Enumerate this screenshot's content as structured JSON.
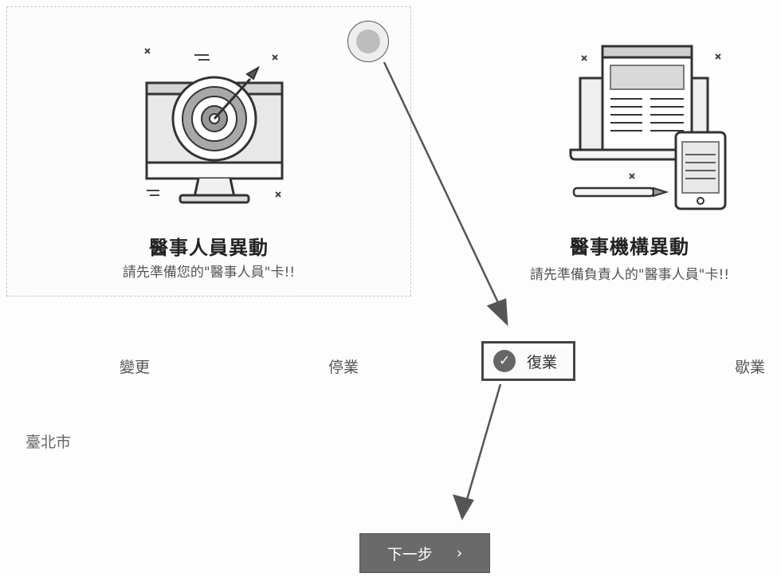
{
  "cards": [
    {
      "title": "醫事人員異動",
      "subtitle": "請先準備您的\"醫事人員\"卡!!",
      "illustration": "target-on-monitor-icon",
      "selected": true
    },
    {
      "title": "醫事機構異動",
      "subtitle": "請先準備負責人的\"醫事人員\"卡!!",
      "illustration": "document-devices-icon",
      "selected": false
    }
  ],
  "options": {
    "change": "變更",
    "suspend": "停業",
    "resume": "復業",
    "closed": "歇業",
    "selected": "resume"
  },
  "location": {
    "city": "臺北市"
  },
  "next_button": {
    "label": "下一步",
    "chevron": "›"
  },
  "colors": {
    "selected_border": "#444444",
    "button_bg": "#6a6a6a",
    "annotation_arrow": "#555555"
  }
}
